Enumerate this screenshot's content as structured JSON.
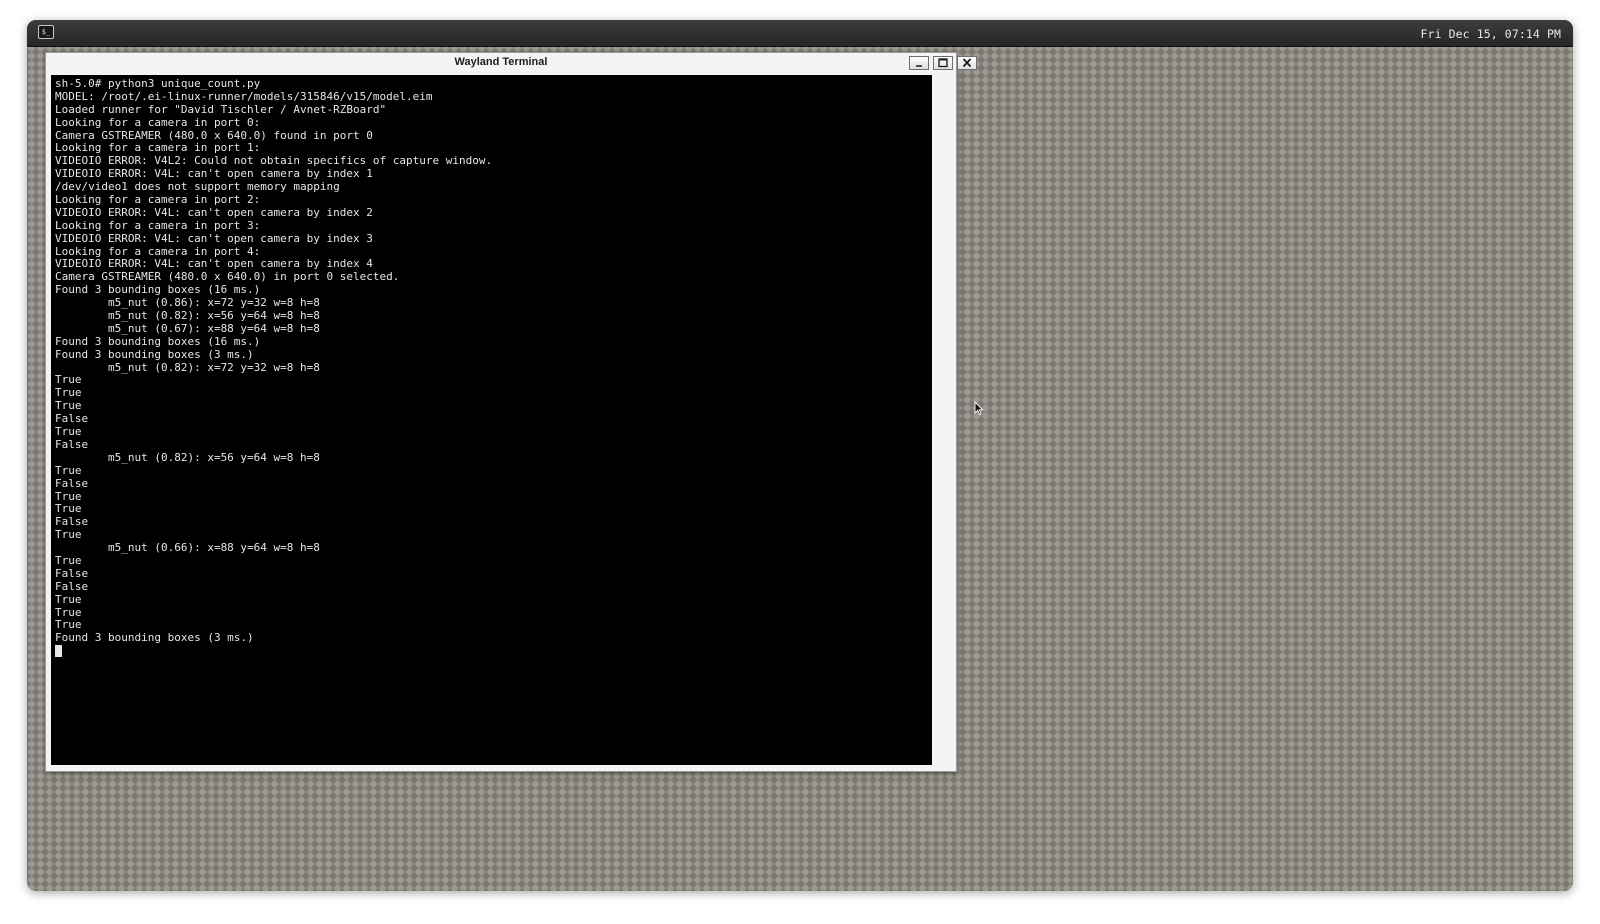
{
  "panel": {
    "launcher_icon": "terminal-launcher-icon",
    "launcher_glyph": "$_",
    "clock": "Fri Dec 15, 07:14 PM"
  },
  "window": {
    "title": "Wayland Terminal",
    "buttons": [
      "minimize",
      "maximize",
      "close"
    ]
  },
  "terminal": {
    "lines": [
      "sh-5.0# python3 unique_count.py",
      "MODEL: /root/.ei-linux-runner/models/315846/v15/model.eim",
      "Loaded runner for \"David Tischler / Avnet-RZBoard\"",
      "Looking for a camera in port 0:",
      "Camera GSTREAMER (480.0 x 640.0) found in port 0",
      "Looking for a camera in port 1:",
      "VIDEOIO ERROR: V4L2: Could not obtain specifics of capture window.",
      "VIDEOIO ERROR: V4L: can't open camera by index 1",
      "/dev/video1 does not support memory mapping",
      "Looking for a camera in port 2:",
      "VIDEOIO ERROR: V4L: can't open camera by index 2",
      "Looking for a camera in port 3:",
      "VIDEOIO ERROR: V4L: can't open camera by index 3",
      "Looking for a camera in port 4:",
      "VIDEOIO ERROR: V4L: can't open camera by index 4",
      "Camera GSTREAMER (480.0 x 640.0) in port 0 selected.",
      "Found 3 bounding boxes (16 ms.)",
      "        m5_nut (0.86): x=72 y=32 w=8 h=8",
      "        m5_nut (0.82): x=56 y=64 w=8 h=8",
      "        m5_nut (0.67): x=88 y=64 w=8 h=8",
      "Found 3 bounding boxes (16 ms.)",
      "Found 3 bounding boxes (3 ms.)",
      "        m5_nut (0.82): x=72 y=32 w=8 h=8",
      "True",
      "True",
      "True",
      "False",
      "True",
      "False",
      "        m5_nut (0.82): x=56 y=64 w=8 h=8",
      "True",
      "False",
      "True",
      "True",
      "False",
      "True",
      "        m5_nut (0.66): x=88 y=64 w=8 h=8",
      "True",
      "False",
      "False",
      "True",
      "True",
      "True",
      "Found 3 bounding boxes (3 ms.)"
    ]
  },
  "colors": {
    "terminal_bg": "#000000",
    "terminal_fg": "#e6e6e6",
    "desktop_bg": "#8a857e",
    "panel_bg": "#2e2e2e"
  }
}
